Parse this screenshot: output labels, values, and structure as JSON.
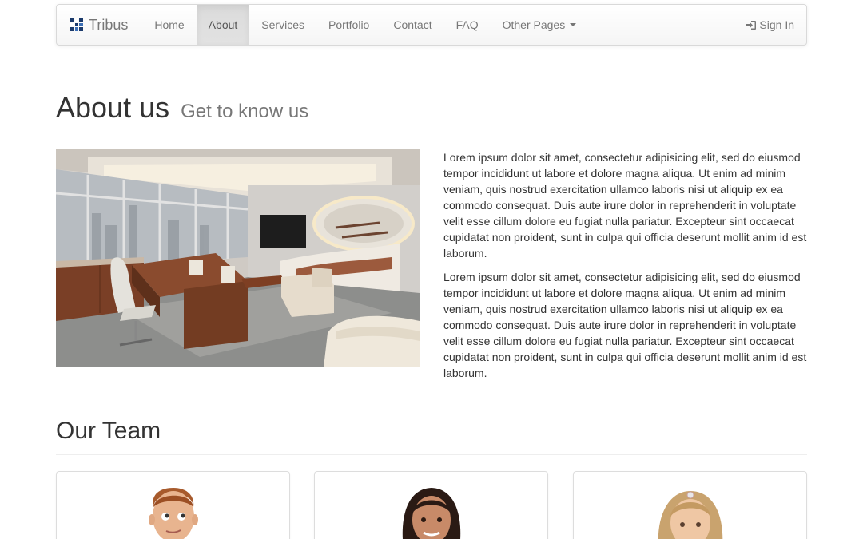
{
  "navbar": {
    "brand": "Tribus",
    "items": [
      {
        "label": "Home"
      },
      {
        "label": "About"
      },
      {
        "label": "Services"
      },
      {
        "label": "Portfolio"
      },
      {
        "label": "Contact"
      },
      {
        "label": "FAQ"
      },
      {
        "label": "Other Pages"
      }
    ],
    "active_item": "About",
    "signin_label": "Sign In",
    "signin_icon": "sign-in-icon",
    "dropdown_icon": "caret-down-icon"
  },
  "about": {
    "title": "About us",
    "subtitle": "Get to know us",
    "paragraphs": [
      "Lorem ipsum dolor sit amet, consectetur adipisicing elit, sed do eiusmod tempor incididunt ut labore et dolore magna aliqua. Ut enim ad minim veniam, quis nostrud exercitation ullamco laboris nisi ut aliquip ex ea commodo consequat. Duis aute irure dolor in reprehenderit in voluptate velit esse cillum dolore eu fugiat nulla pariatur. Excepteur sint occaecat cupidatat non proident, sunt in culpa qui officia deserunt mollit anim id est laborum.",
      "Lorem ipsum dolor sit amet, consectetur adipisicing elit, sed do eiusmod tempor incididunt ut labore et dolore magna aliqua. Ut enim ad minim veniam, quis nostrud exercitation ullamco laboris nisi ut aliquip ex ea commodo consequat. Duis aute irure dolor in reprehenderit in voluptate velit esse cillum dolore eu fugiat nulla pariatur. Excepteur sint occaecat cupidatat non proident, sunt in culpa qui officia deserunt mollit anim id est laborum."
    ]
  },
  "team": {
    "title": "Our Team"
  },
  "colors": {
    "text": "#333333",
    "muted": "#777777",
    "border": "#dddddd",
    "active_bg": "#e2e2e2"
  }
}
